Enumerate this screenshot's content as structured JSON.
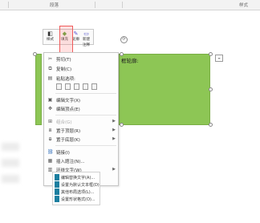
{
  "ribbon": {
    "group_paragraph": "段落",
    "group_style": "样式"
  },
  "mini_toolbar": {
    "buttons": [
      {
        "label": "样式",
        "icon": "style-icon"
      },
      {
        "label": "填充",
        "icon": "fill-bucket-icon"
      },
      {
        "label": "轮廓",
        "icon": "outline-pen-icon"
      },
      {
        "label": "新建注释",
        "icon": "new-comment-icon"
      }
    ],
    "highlight_color": "#ef5a5a"
  },
  "shape": {
    "text": "框轮廓:",
    "fill_color": "#8dc655"
  },
  "context_menu": {
    "items": [
      {
        "label": "剪切(T)",
        "icon": "scissors-icon",
        "arrow": ""
      },
      {
        "label": "复制(C)",
        "icon": "copy-icon",
        "arrow": ""
      },
      {
        "label": "粘贴选项:",
        "icon": "paste-icon",
        "arrow": ""
      },
      {
        "label": "编辑文字(X)",
        "icon": "edit-text-icon",
        "arrow": ""
      },
      {
        "label": "编辑顶点(E)",
        "icon": "edit-points-icon",
        "arrow": ""
      },
      {
        "label": "组合(G)",
        "icon": "group-icon",
        "arrow": "▶"
      },
      {
        "label": "置于顶层(R)",
        "icon": "bring-front-icon",
        "arrow": "▶"
      },
      {
        "label": "置于底层(K)",
        "icon": "send-back-icon",
        "arrow": "▶"
      },
      {
        "label": "链接(I)",
        "icon": "link-icon",
        "arrow": ""
      },
      {
        "label": "插入题注(N)...",
        "icon": "caption-icon",
        "arrow": ""
      },
      {
        "label": "环绕文字(W)",
        "icon": "wrap-text-icon",
        "arrow": "▶"
      }
    ]
  },
  "style_panel": {
    "items": [
      {
        "label": "编辑替换文字(A)..."
      },
      {
        "label": "设置为默认文本框(D)"
      },
      {
        "label": "其他布局选项(L)..."
      },
      {
        "label": "设置形状格式(O)..."
      }
    ],
    "swatch_color": "#1b7fa0"
  }
}
